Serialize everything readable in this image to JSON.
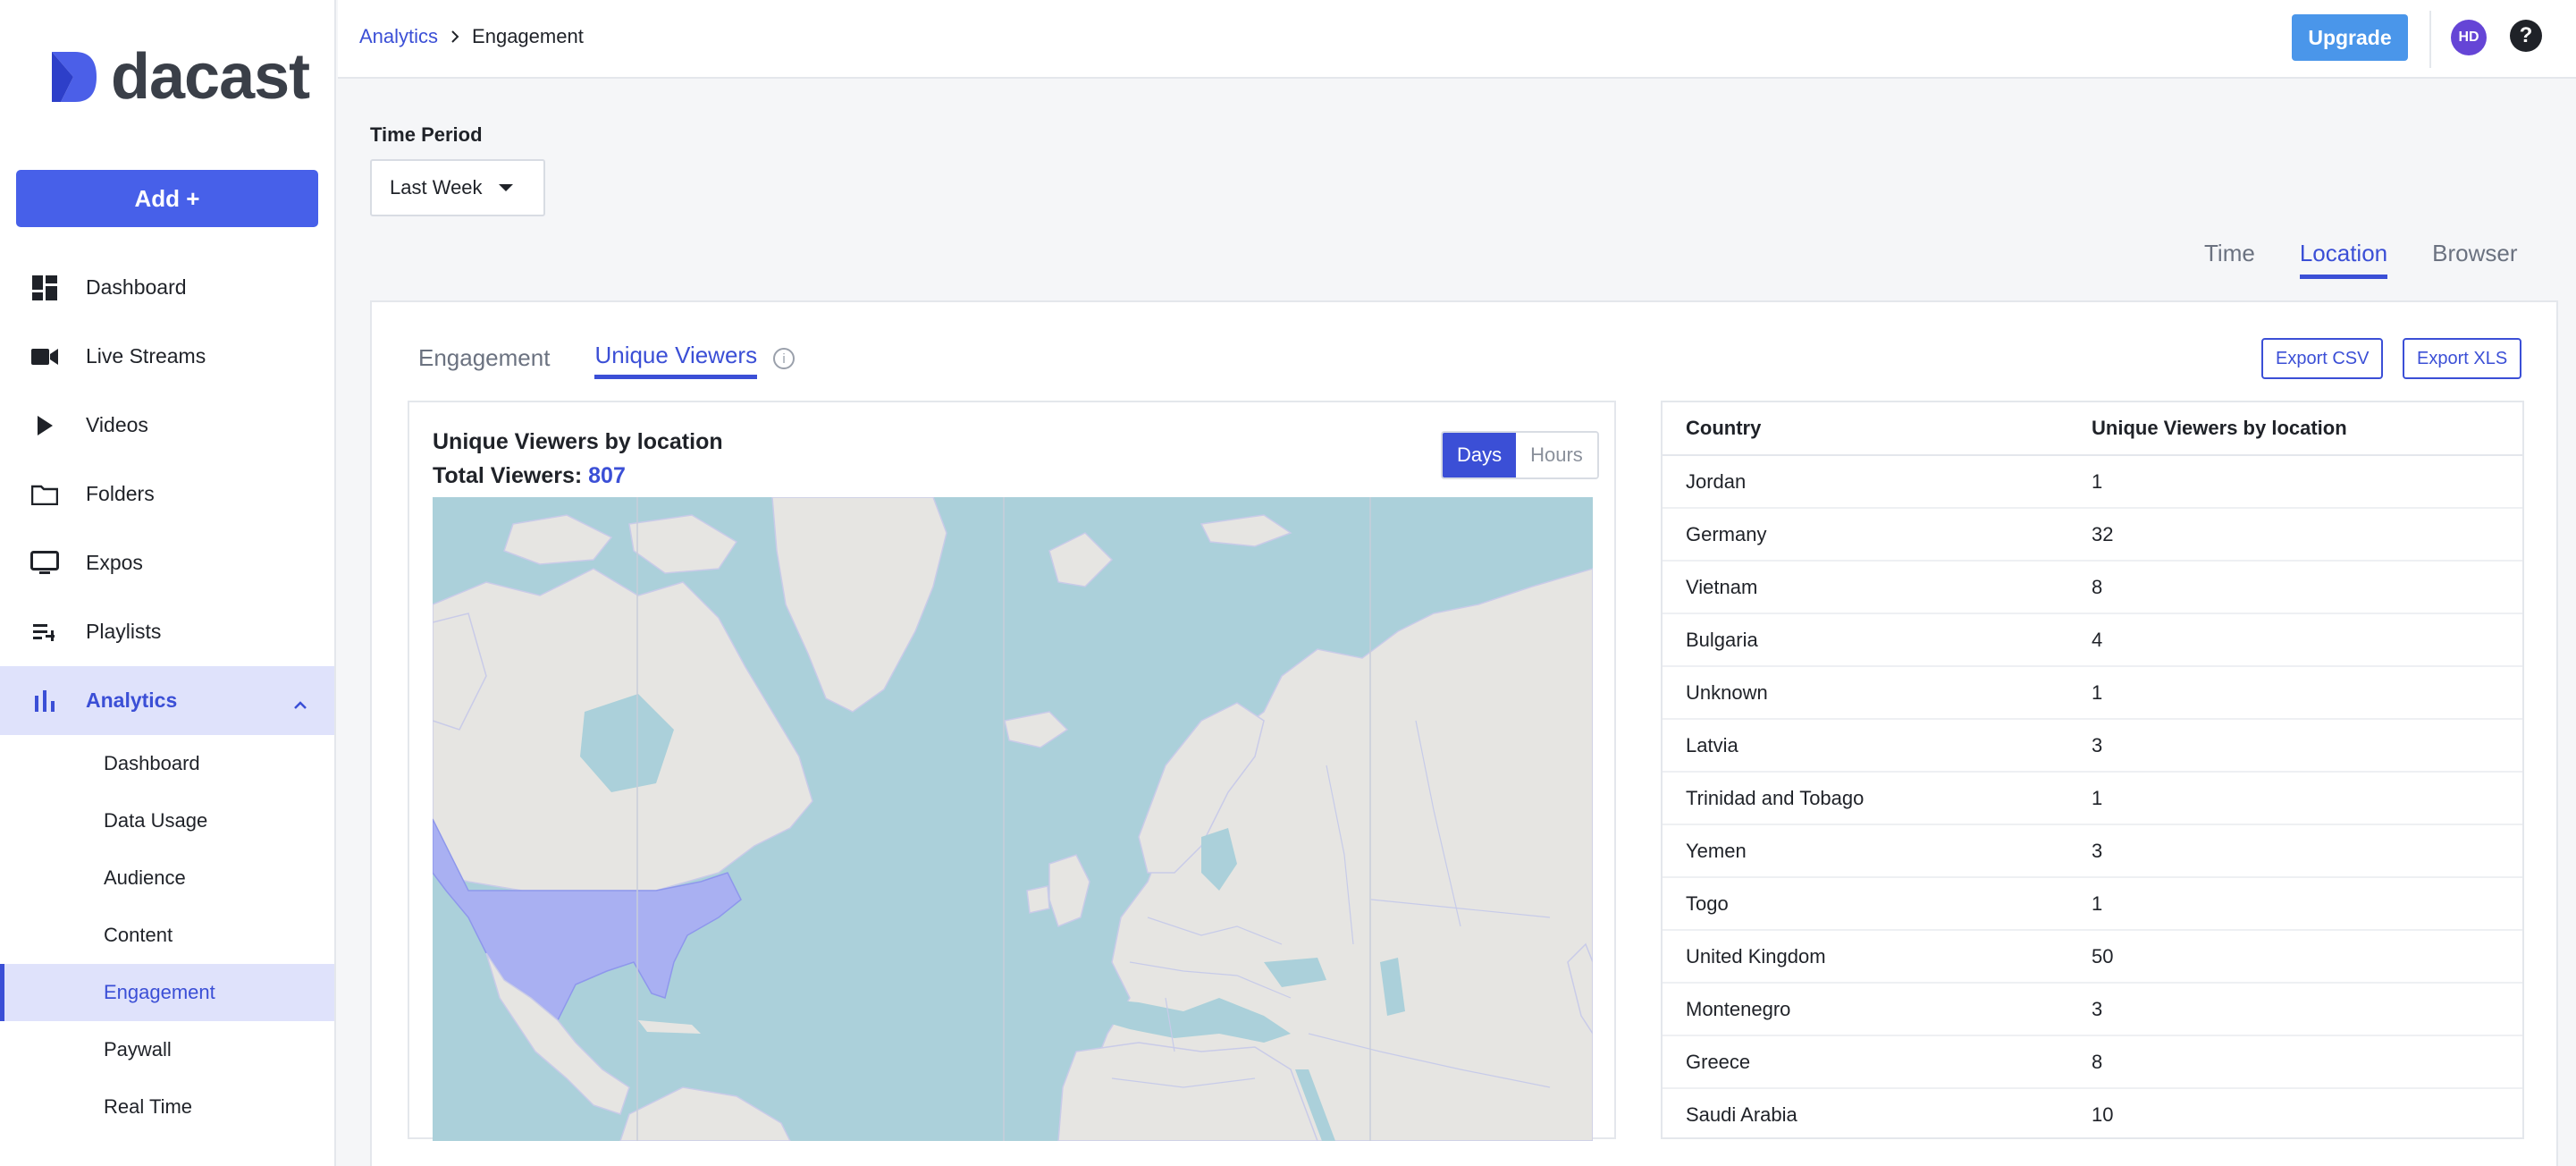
{
  "brand": {
    "name": "dacast",
    "accent": "#3b4fd6"
  },
  "sidebar": {
    "add_label": "Add +",
    "items": [
      {
        "label": "Dashboard",
        "icon": "dashboard-icon"
      },
      {
        "label": "Live Streams",
        "icon": "video-camera-icon"
      },
      {
        "label": "Videos",
        "icon": "play-icon"
      },
      {
        "label": "Folders",
        "icon": "folder-icon"
      },
      {
        "label": "Expos",
        "icon": "monitor-icon"
      },
      {
        "label": "Playlists",
        "icon": "playlist-icon"
      },
      {
        "label": "Analytics",
        "icon": "bar-chart-icon",
        "active": true
      }
    ],
    "analytics_sub": [
      {
        "label": "Dashboard"
      },
      {
        "label": "Data Usage"
      },
      {
        "label": "Audience"
      },
      {
        "label": "Content"
      },
      {
        "label": "Engagement",
        "active": true
      },
      {
        "label": "Paywall"
      },
      {
        "label": "Real Time"
      }
    ]
  },
  "header": {
    "breadcrumb_parent": "Analytics",
    "breadcrumb_current": "Engagement",
    "upgrade_label": "Upgrade",
    "avatar_initials": "HD",
    "help_glyph": "?"
  },
  "filters": {
    "time_period_label": "Time Period",
    "time_period_value": "Last Week"
  },
  "dimension_tabs": [
    {
      "label": "Time"
    },
    {
      "label": "Location",
      "active": true
    },
    {
      "label": "Browser"
    }
  ],
  "content_tabs": [
    {
      "label": "Engagement"
    },
    {
      "label": "Unique Viewers",
      "active": true
    }
  ],
  "exports": {
    "csv_label": "Export CSV",
    "xls_label": "Export XLS"
  },
  "map": {
    "title": "Unique Viewers by location",
    "total_label": "Total Viewers:",
    "total_value": "807",
    "toggle": {
      "days": "Days",
      "hours": "Hours",
      "selected": "Days"
    },
    "water_color": "#abd0da",
    "land_color": "#e6e5e2",
    "highlight_color": "#a9b0f2"
  },
  "table": {
    "columns": [
      "Country",
      "Unique Viewers by location"
    ],
    "rows": [
      [
        "Jordan",
        "1"
      ],
      [
        "Germany",
        "32"
      ],
      [
        "Vietnam",
        "8"
      ],
      [
        "Bulgaria",
        "4"
      ],
      [
        "Unknown",
        "1"
      ],
      [
        "Latvia",
        "3"
      ],
      [
        "Trinidad and Tobago",
        "1"
      ],
      [
        "Yemen",
        "3"
      ],
      [
        "Togo",
        "1"
      ],
      [
        "United Kingdom",
        "50"
      ],
      [
        "Montenegro",
        "3"
      ],
      [
        "Greece",
        "8"
      ],
      [
        "Saudi Arabia",
        "10"
      ]
    ]
  }
}
